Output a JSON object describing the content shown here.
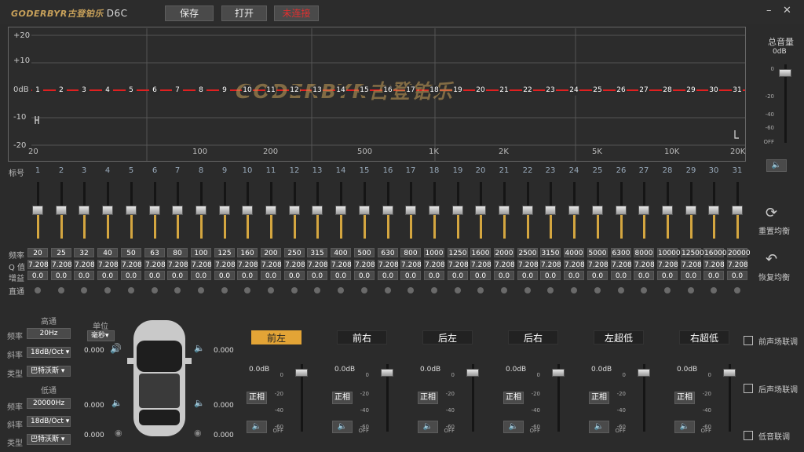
{
  "app": {
    "logo": "GODERBYR古登铂乐",
    "model": "D6C"
  },
  "toolbar": {
    "save": "保存",
    "open": "打开",
    "disconnected": "未连接"
  },
  "window": {
    "min": "–",
    "close": "✕"
  },
  "graph": {
    "y_ticks": [
      "+20",
      "+10",
      "0dB",
      "-10",
      "-20"
    ],
    "x_ticks": [
      "20",
      "100",
      "200",
      "500",
      "1K",
      "2K",
      "5K",
      "10K",
      "20K"
    ],
    "watermark": "GODERBYR古登铂乐"
  },
  "eq": {
    "labels": {
      "index": "标号",
      "freq": "频率",
      "q": "Q 值",
      "gain": "增益",
      "bypass": "直通"
    },
    "bands": [
      "1",
      "2",
      "3",
      "4",
      "5",
      "6",
      "7",
      "8",
      "9",
      "10",
      "11",
      "12",
      "13",
      "14",
      "15",
      "16",
      "17",
      "18",
      "19",
      "20",
      "21",
      "22",
      "23",
      "24",
      "25",
      "26",
      "27",
      "28",
      "29",
      "30",
      "31"
    ],
    "freqs": [
      "20",
      "25",
      "32",
      "40",
      "50",
      "63",
      "80",
      "100",
      "125",
      "160",
      "200",
      "250",
      "315",
      "400",
      "500",
      "630",
      "800",
      "1000",
      "1250",
      "1600",
      "2000",
      "2500",
      "3150",
      "4000",
      "5000",
      "6300",
      "8000",
      "10000",
      "12500",
      "16000",
      "20000"
    ],
    "q": "7.208",
    "gain": "0.0"
  },
  "master": {
    "label": "总音量",
    "value": "0dB",
    "ticks": [
      "0",
      "-20",
      "-40",
      "-60",
      "OFF"
    ]
  },
  "actions": {
    "reset": "重置均衡",
    "restore": "恢复均衡"
  },
  "crossover": {
    "hp_title": "高通",
    "lp_title": "低通",
    "freq_label": "频率",
    "slope_label": "斜率",
    "type_label": "类型",
    "hp_freq": "20Hz",
    "hp_slope": "18dB/Oct",
    "hp_type": "巴特沃斯",
    "lp_freq": "20000Hz",
    "lp_slope": "18dB/Oct",
    "lp_type": "巴特沃斯",
    "unit_label": "单位",
    "unit_value": "毫秒"
  },
  "delays": {
    "fl": "0.000",
    "fr": "0.000",
    "rl": "0.000",
    "rr": "0.000",
    "sl": "0.000",
    "sr": "0.000"
  },
  "channels": [
    {
      "name": "前左",
      "active": true,
      "level": "0.0dB",
      "phase": "正相"
    },
    {
      "name": "前右",
      "active": false,
      "level": "0.0dB",
      "phase": "正相"
    },
    {
      "name": "后左",
      "active": false,
      "level": "0.0dB",
      "phase": "正相"
    },
    {
      "name": "后右",
      "active": false,
      "level": "0.0dB",
      "phase": "正相"
    },
    {
      "name": "左超低",
      "active": false,
      "level": "0.0dB",
      "phase": "正相"
    },
    {
      "name": "右超低",
      "active": false,
      "level": "0.0dB",
      "phase": "正相"
    }
  ],
  "channel_ticks": [
    "0",
    "-20",
    "-40",
    "-60",
    "OFF"
  ],
  "links": {
    "front": "前声场联调",
    "rear": "后声场联调",
    "sub": "低音联调"
  },
  "colors": {
    "accent": "#e3a436",
    "curve": "#e02020",
    "slider_fill": "#d4a640"
  }
}
